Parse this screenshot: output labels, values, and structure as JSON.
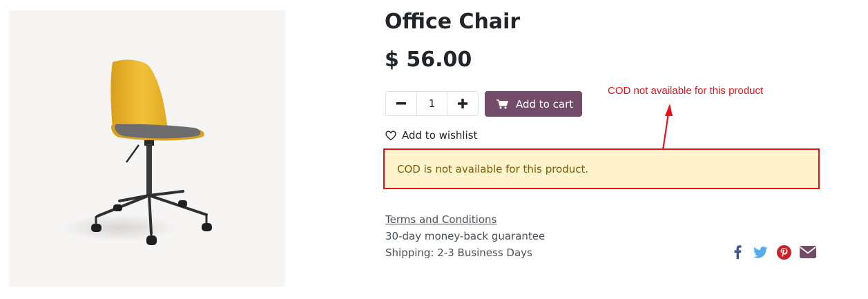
{
  "product": {
    "name": "Office Chair",
    "price": "$ 56.00",
    "quantity": "1"
  },
  "actions": {
    "add_to_cart": "Add to cart",
    "add_to_wishlist": "Add to wishlist"
  },
  "alert": {
    "message": "COD is not available for this product."
  },
  "annotation": {
    "text": "COD not available for this product",
    "color": "#e8111a"
  },
  "info": {
    "terms": "Terms and Conditions",
    "guarantee": "30-day money-back guarantee",
    "shipping": "Shipping: 2-3 Business Days"
  },
  "share": [
    {
      "icon": "facebook-icon",
      "color": "#3b5998"
    },
    {
      "icon": "twitter-icon",
      "color": "#55acee"
    },
    {
      "icon": "pinterest-icon",
      "color": "#cb2027"
    },
    {
      "icon": "envelope-icon",
      "color": "#714b67"
    }
  ],
  "colors": {
    "brand": "#714b67",
    "alert_background": "#fff4cc",
    "alert_text": "#7a5b00"
  }
}
